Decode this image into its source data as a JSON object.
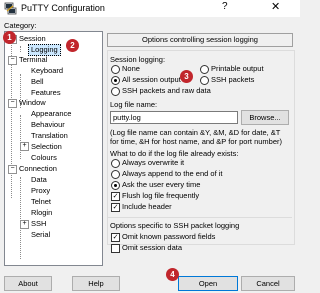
{
  "window": {
    "title": "PuTTY Configuration",
    "help_glyph": "?",
    "close_glyph": "✕"
  },
  "category_label": "Category:",
  "tree": {
    "session": "Session",
    "logging": "Logging",
    "terminal": "Terminal",
    "keyboard": "Keyboard",
    "bell": "Bell",
    "features": "Features",
    "window": "Window",
    "appearance": "Appearance",
    "behaviour": "Behaviour",
    "translation": "Translation",
    "selection": "Selection",
    "colours": "Colours",
    "connection": "Connection",
    "data": "Data",
    "proxy": "Proxy",
    "telnet": "Telnet",
    "rlogin": "Rlogin",
    "ssh": "SSH",
    "serial": "Serial",
    "expand_minus": "−",
    "expand_plus": "+"
  },
  "panel": {
    "header": "Options controlling session logging",
    "session_logging_label": "Session logging:",
    "opt_none": "None",
    "opt_printable": "Printable output",
    "opt_all": "All session output",
    "opt_ssh_packets": "SSH packets",
    "opt_ssh_raw": "SSH packets and raw data",
    "selected_option": "All session output",
    "log_file_label": "Log file name:",
    "log_file_value": "putty.log",
    "browse": "Browse...",
    "hint": "(Log file name can contain &Y, &M, &D for date, &T for time, &H for host name, and &P for port number)",
    "exists_label": "What to do if the log file already exists:",
    "exists_overwrite": "Always overwrite it",
    "exists_append": "Always append to the end of it",
    "exists_ask": "Ask the user every time",
    "flush": "Flush log file frequently",
    "include_header": "Include header",
    "ssh_section": "Options specific to SSH packet logging",
    "omit_passwords": "Omit known password fields",
    "omit_session_data": "Omit session data"
  },
  "buttons": {
    "about": "About",
    "help": "Help",
    "open": "Open",
    "cancel": "Cancel"
  },
  "badges": {
    "b1": "1",
    "b2": "2",
    "b3": "3",
    "b4": "4"
  },
  "colors": {
    "badge": "#c1262c",
    "selection": "#cce8ff",
    "accent": "#0078d7"
  }
}
